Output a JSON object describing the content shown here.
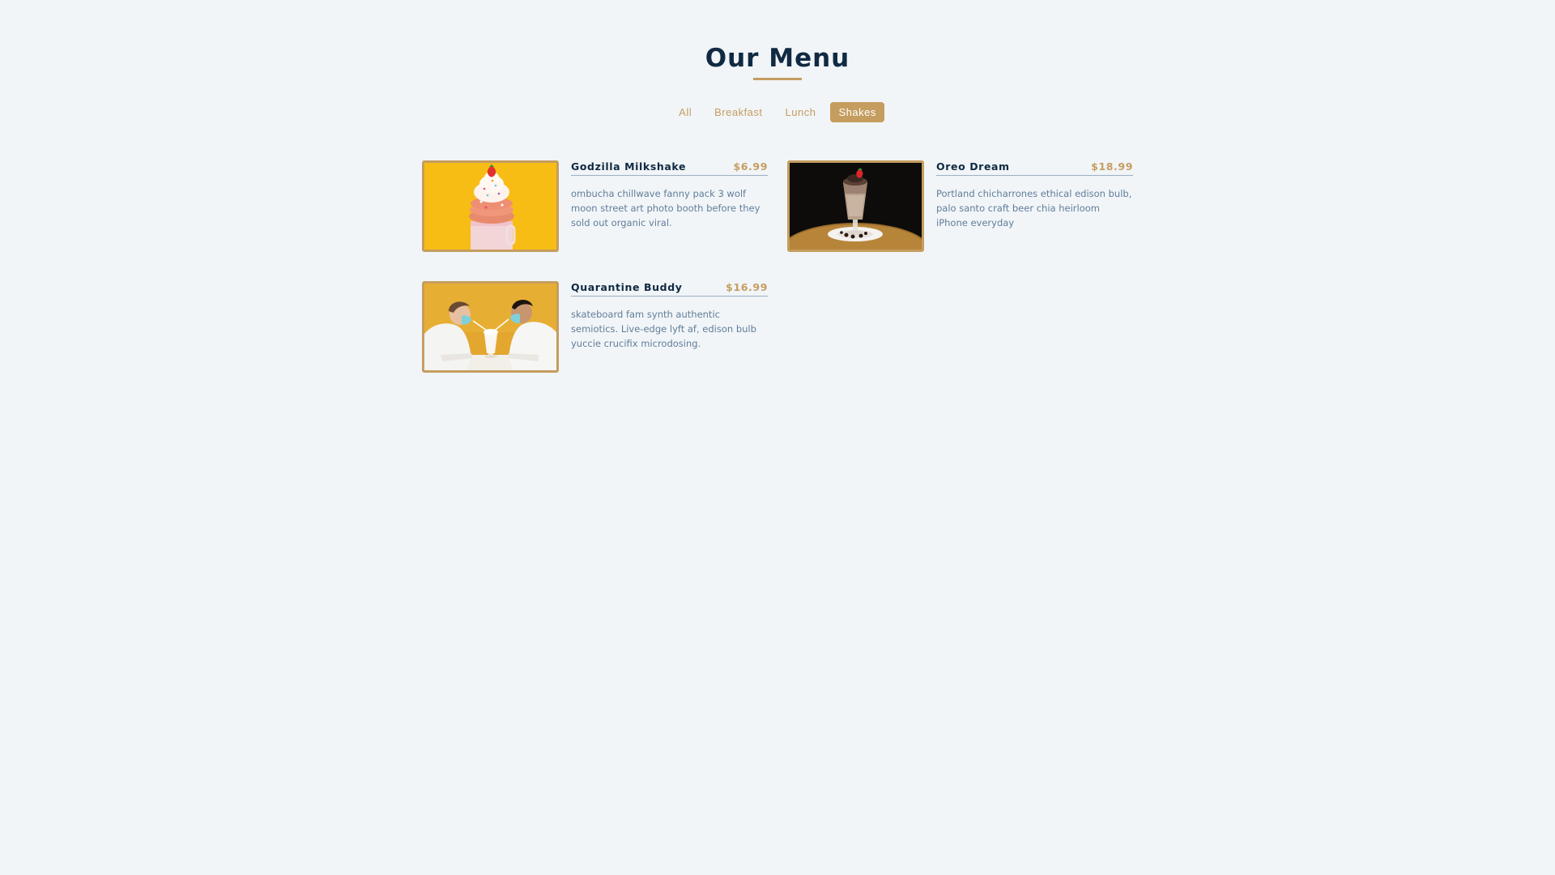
{
  "header": {
    "title": "Our Menu"
  },
  "filters": [
    {
      "label": "All",
      "active": false
    },
    {
      "label": "Breakfast",
      "active": false
    },
    {
      "label": "Lunch",
      "active": false
    },
    {
      "label": "Shakes",
      "active": true
    }
  ],
  "menu": {
    "items": [
      {
        "name": "Godzilla Milkshake",
        "price": "$6.99",
        "description": "ombucha chillwave fanny pack 3 wolf moon street art photo booth before they sold out organic viral.",
        "image": "milkshake-photo"
      },
      {
        "name": "Oreo Dream",
        "price": "$18.99",
        "description": "Portland chicharrones ethical edison bulb, palo santo craft beer chia heirloom iPhone everyday",
        "image": "oreo-shake-photo"
      },
      {
        "name": "Quarantine Buddy",
        "price": "$16.99",
        "description": "skateboard fam synth authentic semiotics. Live-edge lyft af, edison bulb yuccie crucifix microdosing.",
        "image": "couple-sharing-shake-photo"
      }
    ]
  },
  "colors": {
    "background": "#f1f5f8",
    "accent": "#c59d5f",
    "heading": "#102a42",
    "text": "#617d98"
  }
}
